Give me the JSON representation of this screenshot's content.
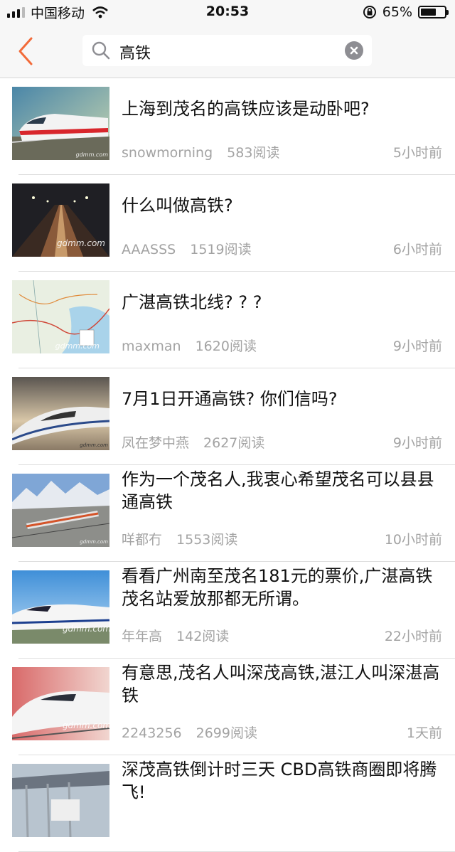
{
  "status_bar": {
    "carrier": "中国移动",
    "time": "20:53",
    "battery": "65%",
    "battery_level": 0.65
  },
  "header": {
    "search_value": "高铁",
    "accent_color": "#f26b3a"
  },
  "articles": [
    {
      "title": "上海到茂名的高铁应该是动卧吧?",
      "author": "snowmorning",
      "reads": "583阅读",
      "time": "5小时前",
      "thumb_icon": "red-train-icon",
      "watermark": "gdmm.com"
    },
    {
      "title": "什么叫做高铁?",
      "author": "AAASSS",
      "reads": "1519阅读",
      "time": "6小时前",
      "thumb_icon": "tunnel-icon",
      "watermark": "gdmm.com"
    },
    {
      "title": "广湛高铁北线? ? ?",
      "author": "maxman",
      "reads": "1620阅读",
      "time": "9小时前",
      "thumb_icon": "map-icon",
      "watermark": "gdmm.com"
    },
    {
      "title": "7月1日开通高铁? 你们信吗?",
      "author": "凤在梦中燕",
      "reads": "2627阅读",
      "time": "9小时前",
      "thumb_icon": "bullet-train-icon",
      "watermark": "gdmm.com"
    },
    {
      "title": "作为一个茂名人,我衷心希望茂名可以县县通高铁",
      "author": "咩都冇",
      "reads": "1553阅读",
      "time": "10小时前",
      "thumb_icon": "mountain-train-icon",
      "watermark": "gdmm.com"
    },
    {
      "title": "看看广州南至茂名181元的票价,广湛高铁茂名站爱放那都无所谓。",
      "author": "年年高",
      "reads": "142阅读",
      "time": "22小时前",
      "thumb_icon": "crh-train-icon",
      "watermark": "gdmm.com"
    },
    {
      "title": "有意思,茂名人叫深茂高铁,湛江人叫深湛高铁",
      "author": "2243256",
      "reads": "2699阅读",
      "time": "1天前",
      "thumb_icon": "white-train-icon",
      "watermark": "gdmm.com"
    },
    {
      "title": "深茂高铁倒计时三天 CBD高铁商圈即将腾飞!",
      "author": "",
      "reads": "",
      "time": "",
      "thumb_icon": "station-icon",
      "watermark": ""
    }
  ]
}
